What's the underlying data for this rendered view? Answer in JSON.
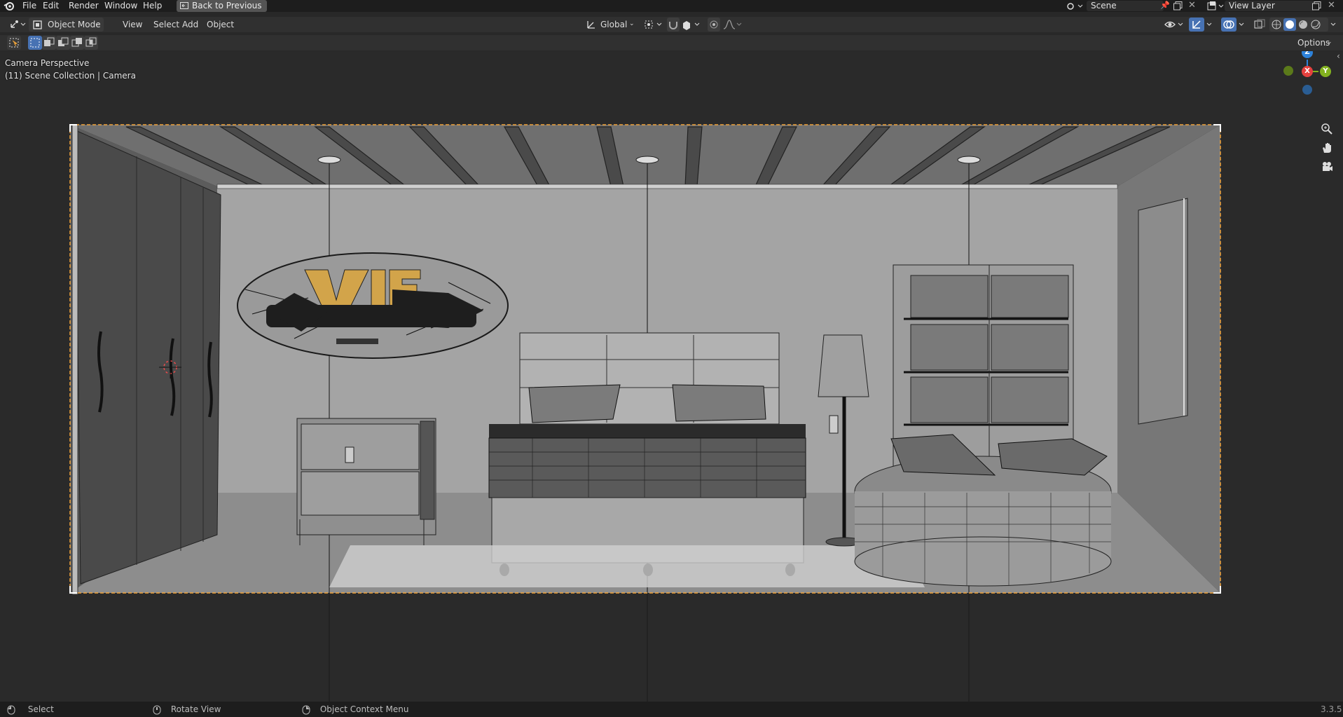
{
  "topbar": {
    "menus": [
      "File",
      "Edit",
      "Render",
      "Window",
      "Help"
    ],
    "back_button": "Back to Previous",
    "scene_name": "Scene",
    "view_layer": "View Layer"
  },
  "header": {
    "mode": "Object Mode",
    "menus": [
      "View",
      "Select",
      "Add",
      "Object"
    ],
    "transform_orientation": "Global",
    "options_label": "Options"
  },
  "viewport": {
    "perspective_label": "Camera Perspective",
    "collection_label": "(11) Scene Collection | Camera",
    "gizmo_axes": {
      "z": "Z",
      "x": "X",
      "y": "Y"
    },
    "colors": {
      "x_axis": "#e5413f",
      "y_axis": "#83b21f",
      "z_axis": "#2d82da",
      "camera_border": "#f2a33a",
      "logo_accent": "#d2a44a"
    }
  },
  "statusbar": {
    "select": "Select",
    "rotate": "Rotate View",
    "context_menu": "Object Context Menu",
    "version": "3.3.5"
  }
}
